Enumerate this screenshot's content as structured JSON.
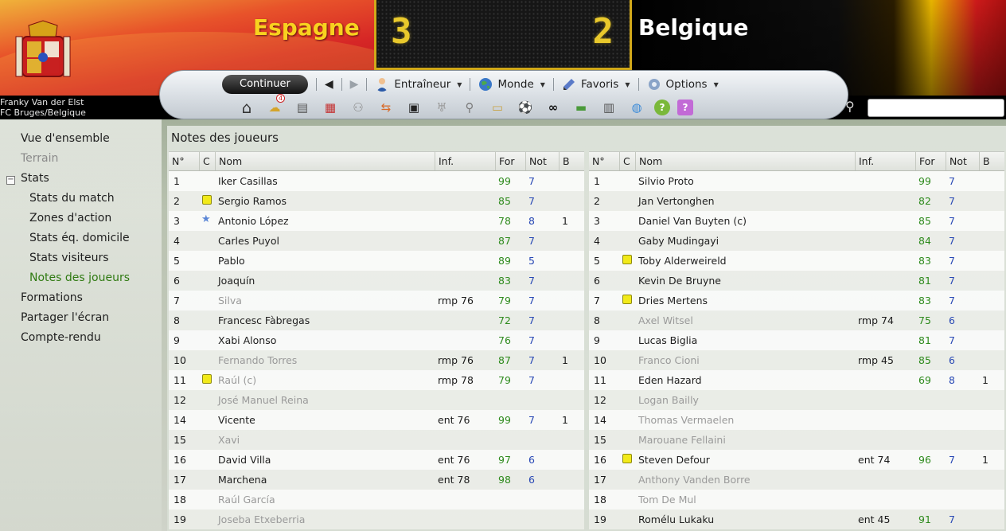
{
  "match": {
    "home_team": "Espagne",
    "away_team": "Belgique",
    "home_score": "3",
    "away_score": "2"
  },
  "manager": {
    "name": "Franky Van der Elst",
    "club": "FC Bruges/Belgique"
  },
  "toolbar": {
    "continue_label": "Continuer",
    "menus": [
      {
        "label": "Entraîneur",
        "icon": "coach-icon"
      },
      {
        "label": "Monde",
        "icon": "globe-icon"
      },
      {
        "label": "Favoris",
        "icon": "bookmark-icon"
      },
      {
        "label": "Options",
        "icon": "options-icon"
      }
    ],
    "icons": [
      "home-icon",
      "inbox-icon",
      "notes-icon",
      "calendar-icon",
      "squad-icon",
      "transfers-icon",
      "tactics-icon",
      "trophy-icon",
      "scouting-icon",
      "clipboard-icon",
      "training-icon",
      "binoculars-icon",
      "finances-icon",
      "reports-icon",
      "world-icon",
      "help-icon",
      "question-icon"
    ],
    "inbox_badge": "4"
  },
  "sidebar": {
    "items": [
      {
        "label": "Vue d'ensemble"
      },
      {
        "label": "Terrain"
      },
      {
        "label": "Stats"
      },
      {
        "label": "Stats du match"
      },
      {
        "label": "Zones d'action"
      },
      {
        "label": "Stats éq. domicile"
      },
      {
        "label": "Stats visiteurs"
      },
      {
        "label": "Notes des joueurs"
      },
      {
        "label": "Formations"
      },
      {
        "label": "Partager l'écran"
      },
      {
        "label": "Compte-rendu"
      }
    ],
    "stats_toggle": "−"
  },
  "main": {
    "title": "Notes des joueurs",
    "columns": {
      "num": "N°",
      "card": "C",
      "name": "Nom",
      "inf": "Inf.",
      "for": "For",
      "not": "Not",
      "b": "B"
    },
    "home_players": [
      {
        "num": "1",
        "card": "",
        "name": "Iker Casillas",
        "inf": "",
        "for": "99",
        "not": "7",
        "b": "",
        "played": true
      },
      {
        "num": "2",
        "card": "yellow",
        "name": "Sergio Ramos",
        "inf": "",
        "for": "85",
        "not": "7",
        "b": "",
        "played": true
      },
      {
        "num": "3",
        "card": "star",
        "name": "Antonio López",
        "inf": "",
        "for": "78",
        "not": "8",
        "b": "1",
        "played": true
      },
      {
        "num": "4",
        "card": "",
        "name": "Carles Puyol",
        "inf": "",
        "for": "87",
        "not": "7",
        "b": "",
        "played": true
      },
      {
        "num": "5",
        "card": "",
        "name": "Pablo",
        "inf": "",
        "for": "89",
        "not": "5",
        "b": "",
        "played": true
      },
      {
        "num": "6",
        "card": "",
        "name": "Joaquín",
        "inf": "",
        "for": "83",
        "not": "7",
        "b": "",
        "played": true
      },
      {
        "num": "7",
        "card": "",
        "name": "Silva",
        "inf": "rmp 76",
        "for": "79",
        "not": "7",
        "b": "",
        "played": false
      },
      {
        "num": "8",
        "card": "",
        "name": "Francesc Fàbregas",
        "inf": "",
        "for": "72",
        "not": "7",
        "b": "",
        "played": true
      },
      {
        "num": "9",
        "card": "",
        "name": "Xabi Alonso",
        "inf": "",
        "for": "76",
        "not": "7",
        "b": "",
        "played": true
      },
      {
        "num": "10",
        "card": "",
        "name": "Fernando Torres",
        "inf": "rmp 76",
        "for": "87",
        "not": "7",
        "b": "1",
        "played": false
      },
      {
        "num": "11",
        "card": "yellow",
        "name": "Raúl (c)",
        "inf": "rmp 78",
        "for": "79",
        "not": "7",
        "b": "",
        "played": false
      },
      {
        "num": "12",
        "card": "",
        "name": "José Manuel Reina",
        "inf": "",
        "for": "",
        "not": "",
        "b": "",
        "played": false
      },
      {
        "num": "14",
        "card": "",
        "name": "Vicente",
        "inf": "ent 76",
        "for": "99",
        "not": "7",
        "b": "1",
        "played": true
      },
      {
        "num": "15",
        "card": "",
        "name": "Xavi",
        "inf": "",
        "for": "",
        "not": "",
        "b": "",
        "played": false
      },
      {
        "num": "16",
        "card": "",
        "name": "David Villa",
        "inf": "ent 76",
        "for": "97",
        "not": "6",
        "b": "",
        "played": true
      },
      {
        "num": "17",
        "card": "",
        "name": "Marchena",
        "inf": "ent 78",
        "for": "98",
        "not": "6",
        "b": "",
        "played": true
      },
      {
        "num": "18",
        "card": "",
        "name": "Raúl García",
        "inf": "",
        "for": "",
        "not": "",
        "b": "",
        "played": false
      },
      {
        "num": "19",
        "card": "",
        "name": "Joseba Etxeberria",
        "inf": "",
        "for": "",
        "not": "",
        "b": "",
        "played": false
      }
    ],
    "away_players": [
      {
        "num": "1",
        "card": "",
        "name": "Silvio Proto",
        "inf": "",
        "for": "99",
        "not": "7",
        "b": "",
        "played": true
      },
      {
        "num": "2",
        "card": "",
        "name": "Jan Vertonghen",
        "inf": "",
        "for": "82",
        "not": "7",
        "b": "",
        "played": true
      },
      {
        "num": "3",
        "card": "",
        "name": "Daniel Van Buyten (c)",
        "inf": "",
        "for": "85",
        "not": "7",
        "b": "",
        "played": true
      },
      {
        "num": "4",
        "card": "",
        "name": "Gaby Mudingayi",
        "inf": "",
        "for": "84",
        "not": "7",
        "b": "",
        "played": true
      },
      {
        "num": "5",
        "card": "yellow",
        "name": "Toby Alderweireld",
        "inf": "",
        "for": "83",
        "not": "7",
        "b": "",
        "played": true
      },
      {
        "num": "6",
        "card": "",
        "name": "Kevin De Bruyne",
        "inf": "",
        "for": "81",
        "not": "7",
        "b": "",
        "played": true
      },
      {
        "num": "7",
        "card": "yellow",
        "name": "Dries Mertens",
        "inf": "",
        "for": "83",
        "not": "7",
        "b": "",
        "played": true
      },
      {
        "num": "8",
        "card": "",
        "name": "Axel Witsel",
        "inf": "rmp 74",
        "for": "75",
        "not": "6",
        "b": "",
        "played": false
      },
      {
        "num": "9",
        "card": "",
        "name": "Lucas Biglia",
        "inf": "",
        "for": "81",
        "not": "7",
        "b": "",
        "played": true
      },
      {
        "num": "10",
        "card": "",
        "name": "Franco Cioni",
        "inf": "rmp 45",
        "for": "85",
        "not": "6",
        "b": "",
        "played": false
      },
      {
        "num": "11",
        "card": "",
        "name": "Eden Hazard",
        "inf": "",
        "for": "69",
        "not": "8",
        "b": "1",
        "played": true
      },
      {
        "num": "12",
        "card": "",
        "name": "Logan Bailly",
        "inf": "",
        "for": "",
        "not": "",
        "b": "",
        "played": false
      },
      {
        "num": "14",
        "card": "",
        "name": "Thomas Vermaelen",
        "inf": "",
        "for": "",
        "not": "",
        "b": "",
        "played": false
      },
      {
        "num": "15",
        "card": "",
        "name": "Marouane Fellaini",
        "inf": "",
        "for": "",
        "not": "",
        "b": "",
        "played": false
      },
      {
        "num": "16",
        "card": "yellow",
        "name": "Steven Defour",
        "inf": "ent 74",
        "for": "96",
        "not": "7",
        "b": "1",
        "played": true
      },
      {
        "num": "17",
        "card": "",
        "name": "Anthony Vanden Borre",
        "inf": "",
        "for": "",
        "not": "",
        "b": "",
        "played": false
      },
      {
        "num": "18",
        "card": "",
        "name": "Tom De Mul",
        "inf": "",
        "for": "",
        "not": "",
        "b": "",
        "played": false
      },
      {
        "num": "19",
        "card": "",
        "name": "Romélu Lukaku",
        "inf": "ent 45",
        "for": "91",
        "not": "7",
        "b": "",
        "played": true
      }
    ]
  },
  "colors": {
    "home_name": "#f8d21f",
    "score": "#e9c92c",
    "for_value": "#2d8a1c",
    "note_value": "#2848b4",
    "active_sidebar": "#2f7a12",
    "yellow_card": "#f2ea1a"
  }
}
